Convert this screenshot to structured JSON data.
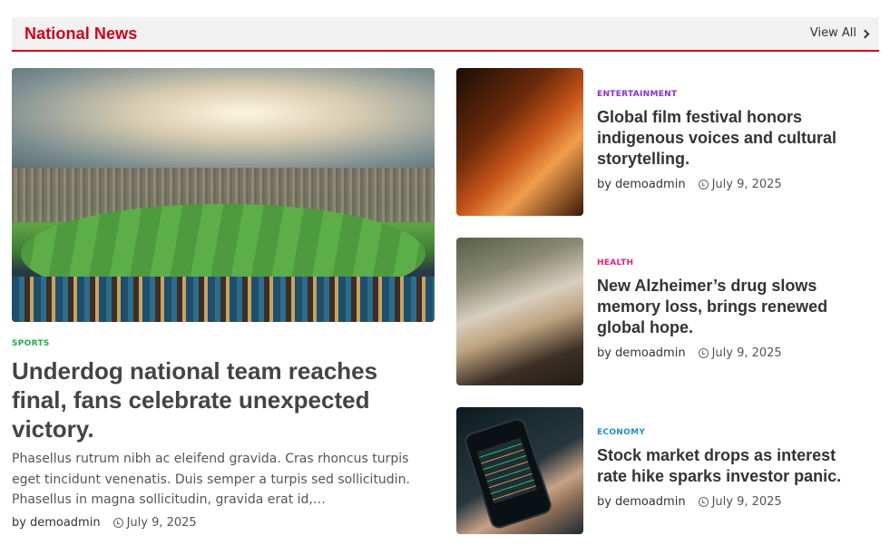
{
  "header": {
    "section_title": "National News",
    "view_all": "View All"
  },
  "featured": {
    "category": "SPORTS",
    "category_color": "#2aa84a",
    "title": "Underdog national team reaches final, fans celebrate unexpected victory.",
    "excerpt": "Phasellus rutrum nibh ac eleifend gravida. Cras rhoncus turpis eget tincidunt venenatis. Duis semper a turpis sed sollicitudin. Phasellus in magna sollicitudin, gravida erat id,…",
    "by": "by",
    "author": "demoadmin",
    "date": "July 9, 2025"
  },
  "side_articles": [
    {
      "category": "ENTERTAINMENT",
      "category_color": "#8a2be2",
      "title": "Global film festival honors indigenous voices and cultural storytelling.",
      "by": "by",
      "author": "demoadmin",
      "date": "July 9, 2025"
    },
    {
      "category": "HEALTH",
      "category_color": "#e0247a",
      "title": "New Alzheimer’s drug slows memory loss, brings renewed global hope.",
      "by": "by",
      "author": "demoadmin",
      "date": "July 9, 2025"
    },
    {
      "category": "ECONOMY",
      "category_color": "#1f8fc4",
      "title": "Stock market drops as interest rate hike sparks investor panic.",
      "by": "by",
      "author": "demoadmin",
      "date": "July 9, 2025"
    }
  ],
  "colors": {
    "accent": "#d0021b",
    "header_bg": "#f1f1f1"
  },
  "icons": {
    "view_all": "chevron-right-icon",
    "date": "clock-icon"
  }
}
